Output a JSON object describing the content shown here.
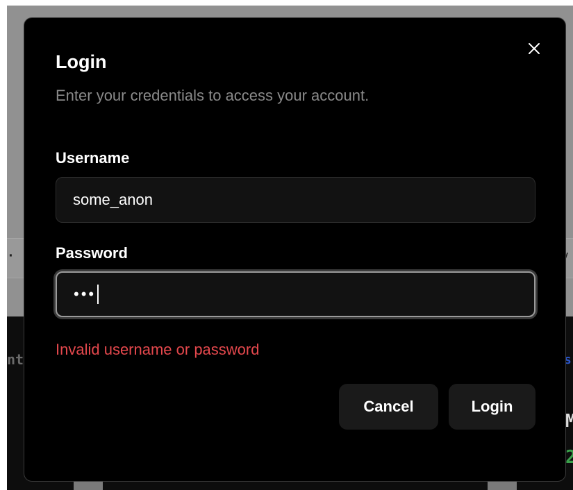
{
  "dialog": {
    "title": "Login",
    "subtitle": "Enter your credentials to access your account.",
    "close_icon": "close-icon"
  },
  "form": {
    "username_label": "Username",
    "username_value": "some_anon",
    "password_label": "Password",
    "password_masked": "•••",
    "error_message": "Invalid username or password"
  },
  "actions": {
    "cancel_label": "Cancel",
    "login_label": "Login"
  },
  "background": {
    "glyph_dots": "· ·",
    "glyph_v": "v",
    "glyph_nt": "nt",
    "glyph_s": "s",
    "glyph_m": "M",
    "glyph_2": "2"
  },
  "colors": {
    "dialog_bg": "#000000",
    "input_bg": "#121212",
    "button_bg": "#1a1a1a",
    "error": "#e5484d",
    "muted_text": "#8a8a8a"
  }
}
